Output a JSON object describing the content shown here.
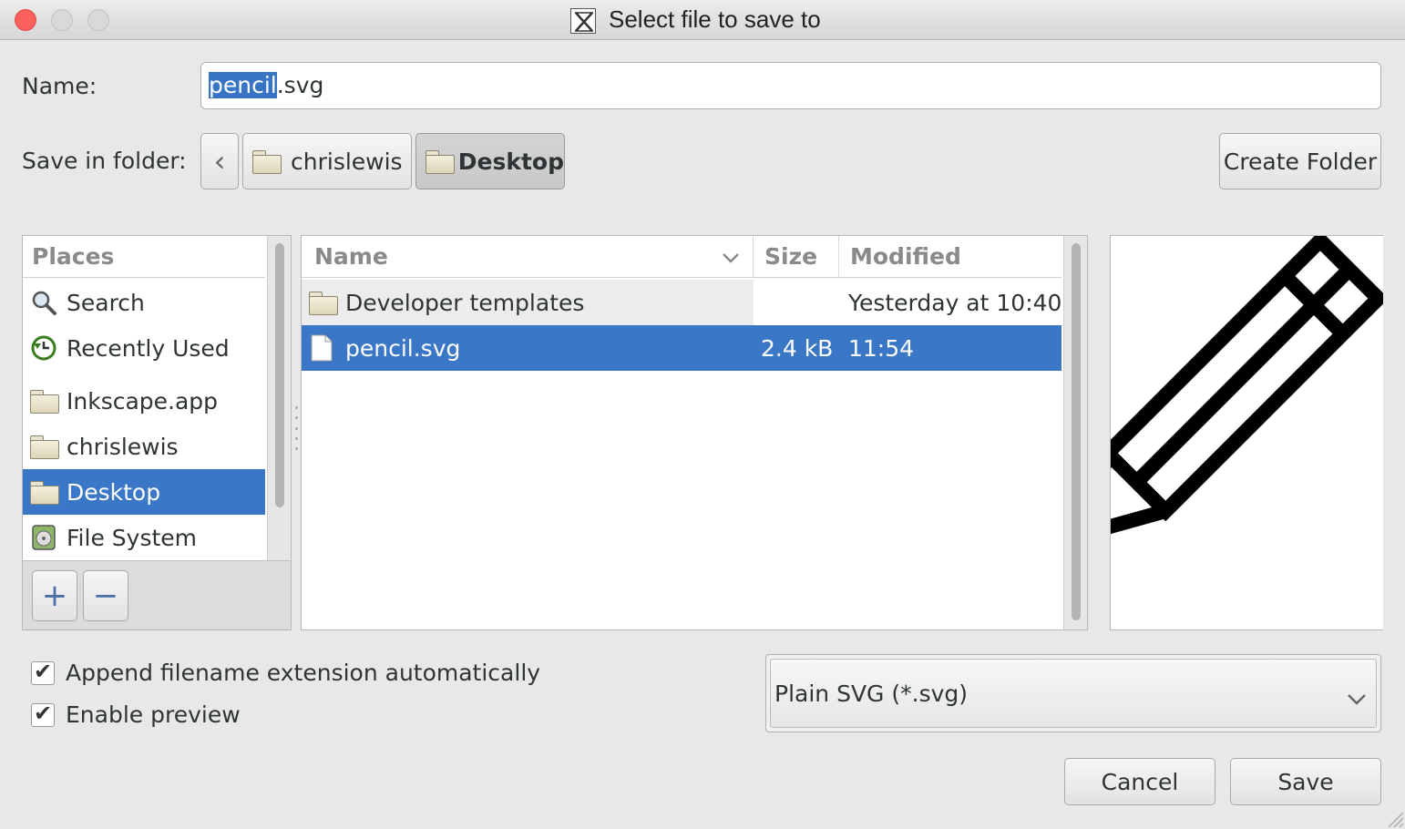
{
  "window": {
    "title": "Select file to save to"
  },
  "name_field": {
    "label": "Name:",
    "value_selected": "pencil",
    "value_rest": ".svg"
  },
  "save_in": {
    "label": "Save in folder:",
    "back_symbol": "‹",
    "crumbs": [
      "chrislewis",
      "Desktop"
    ],
    "create_folder_label": "Create Folder"
  },
  "places": {
    "header": "Places",
    "items": [
      {
        "label": "Search",
        "icon": "search-icon"
      },
      {
        "label": "Recently Used",
        "icon": "recent-icon"
      },
      {
        "label": "Inkscape.app",
        "icon": "folder-icon"
      },
      {
        "label": "chrislewis",
        "icon": "folder-icon"
      },
      {
        "label": "Desktop",
        "icon": "folder-icon"
      },
      {
        "label": "File System",
        "icon": "drive-icon"
      }
    ],
    "add_symbol": "+",
    "remove_symbol": "−"
  },
  "files": {
    "columns": {
      "name": "Name",
      "size": "Size",
      "modified": "Modified"
    },
    "rows": [
      {
        "name": "Developer templates",
        "size": "",
        "modified": "Yesterday at 10:40",
        "icon": "folder-icon"
      },
      {
        "name": "pencil.svg",
        "size": "2.4 kB",
        "modified": "11:54",
        "icon": "file-icon"
      }
    ]
  },
  "options": {
    "append_extension": "Append filename extension automatically",
    "enable_preview": "Enable preview"
  },
  "filetype": {
    "selected": "Plain SVG (*.svg)"
  },
  "actions": {
    "cancel": "Cancel",
    "save": "Save"
  },
  "colors": {
    "selection": "#3b77c7",
    "close": "#fc605c"
  }
}
